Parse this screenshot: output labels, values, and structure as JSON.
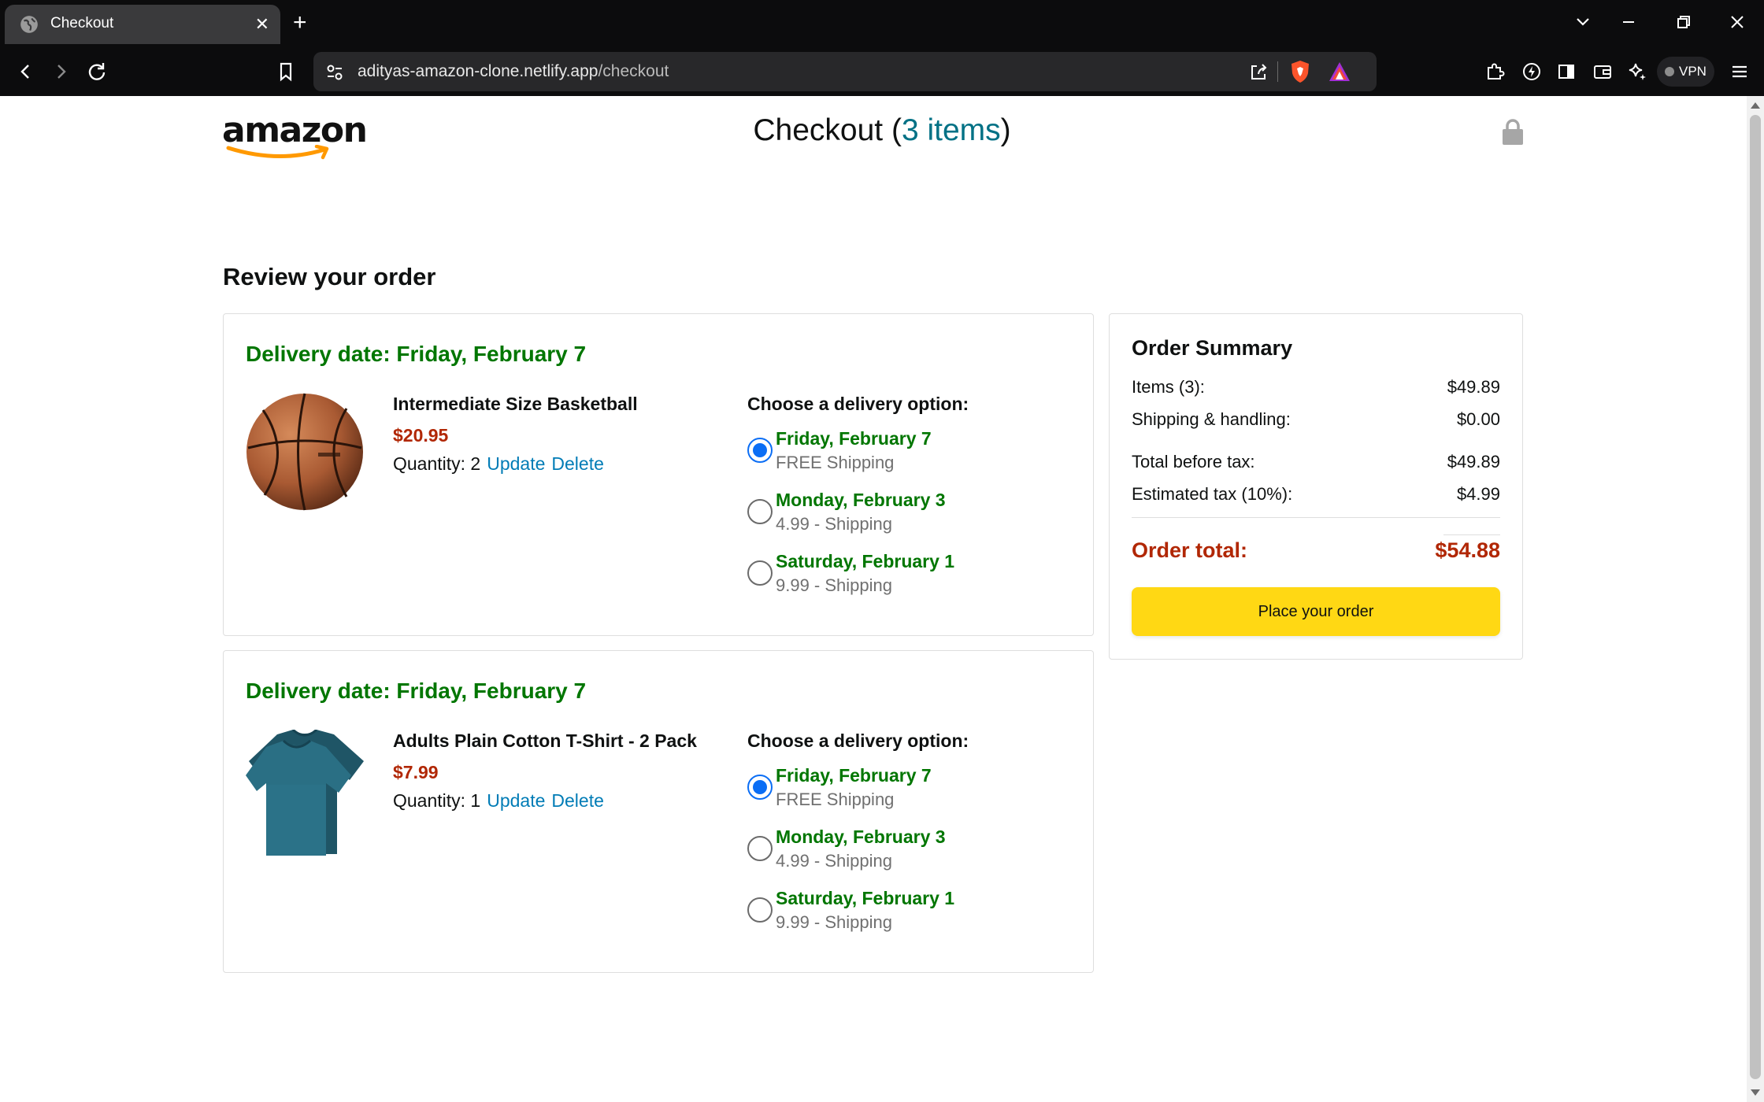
{
  "browser": {
    "tab_title": "Checkout",
    "new_tab_label": "+",
    "url_host": "adityas-amazon-clone.netlify.app",
    "url_path": "/checkout",
    "vpn_label": "VPN"
  },
  "header": {
    "logo_text": "amazon",
    "title_prefix": "Checkout (",
    "items_link": "3 items",
    "title_suffix": ")"
  },
  "review": {
    "heading": "Review your order",
    "options_heading": "Choose a delivery option:",
    "update_label": "Update",
    "delete_label": "Delete",
    "items": [
      {
        "delivery_date": "Delivery date: Friday, February 7",
        "name": "Intermediate Size Basketball",
        "price": "$20.95",
        "quantity": "Quantity: 2",
        "image_icon": "basketball-image",
        "options": [
          {
            "date": "Friday, February 7",
            "price": "FREE Shipping",
            "checked": true
          },
          {
            "date": "Monday, February 3",
            "price": "4.99 - Shipping",
            "checked": false
          },
          {
            "date": "Saturday, February 1",
            "price": "9.99 - Shipping",
            "checked": false
          }
        ]
      },
      {
        "delivery_date": "Delivery date: Friday, February 7",
        "name": "Adults Plain Cotton T-Shirt - 2 Pack",
        "price": "$7.99",
        "quantity": "Quantity: 1",
        "image_icon": "tshirt-image",
        "options": [
          {
            "date": "Friday, February 7",
            "price": "FREE Shipping",
            "checked": true
          },
          {
            "date": "Monday, February 3",
            "price": "4.99 - Shipping",
            "checked": false
          },
          {
            "date": "Saturday, February 1",
            "price": "9.99 - Shipping",
            "checked": false
          }
        ]
      }
    ]
  },
  "summary": {
    "heading": "Order Summary",
    "items_label": "Items (3):",
    "items_value": "$49.89",
    "shipping_label": "Shipping & handling:",
    "shipping_value": "$0.00",
    "before_tax_label": "Total before tax:",
    "before_tax_value": "$49.89",
    "tax_label": "Estimated tax (10%):",
    "tax_value": "$4.99",
    "total_label": "Order total:",
    "total_value": "$54.88",
    "place_order_label": "Place your order"
  },
  "colors": {
    "green": "#007600",
    "price_red": "#b12704",
    "link_blue": "#017cb6",
    "teal": "#017185",
    "button_yellow": "#ffd814",
    "radio_blue": "#0b6ef5"
  }
}
